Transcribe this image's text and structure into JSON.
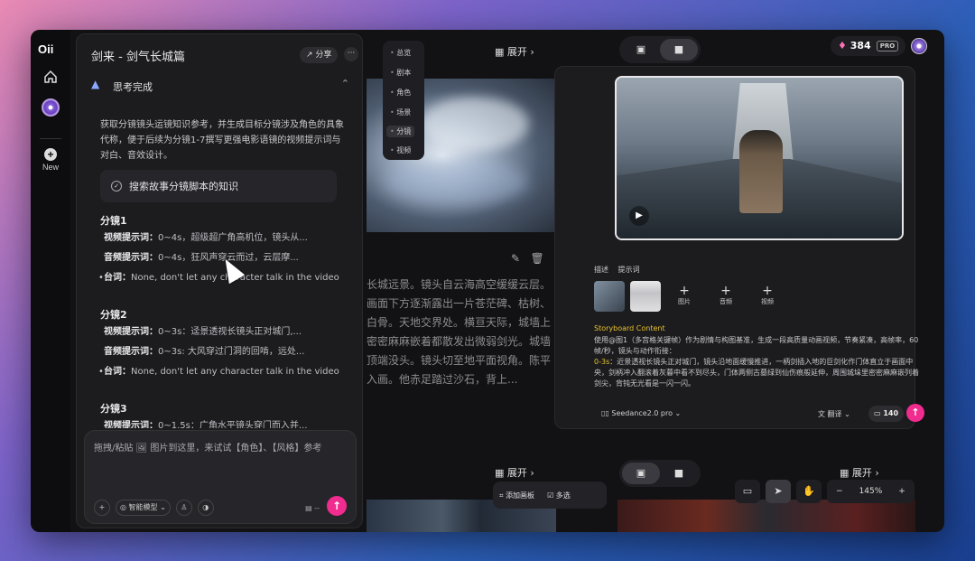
{
  "app": {
    "logo": "Oii",
    "new_label": "New"
  },
  "chat": {
    "title": "剑来 - 剑气长城篇",
    "share_label": "分享",
    "more_label": "···",
    "thinking_label": "思考完成",
    "intro": "获取分镜镜头运镜知识参考，并生成目标分镜涉及角色的具象代称，便于后续为分镜1-7撰写更强电影语镜的视频提示词与对白、音效设计。",
    "search_task": "搜索故事分镜脚本的知识",
    "shots": [
      {
        "heading": "分镜1",
        "video_label": "视频提示词：",
        "video_text": "0~4s，超级超广角高机位，镜头从...",
        "audio_label": "音频提示词：",
        "audio_text": "0~4s，狂风声穿云而过，云层摩...",
        "line_label": "台词：",
        "line_text": "None, don't let any character talk in the video"
      },
      {
        "heading": "分镜2",
        "video_label": "视频提示词：",
        "video_text": "0~3s：迳景透视长镜头正对城门,...",
        "audio_label": "音频提示词：",
        "audio_text": "0~3s: 大风穿过门洞的回啃，远处...",
        "line_label": "台词：",
        "line_text": "None, don't let any character talk in the video"
      },
      {
        "heading": "分镜3",
        "video_label": "视频提示词：",
        "video_text": "0~1.5s：广角水平镜头穿门而入并..."
      }
    ],
    "input_placeholder": "拖拽/粘贴 🖼 图片到这里，来试试【角色】、【风格】参考",
    "model_label": "智能模型",
    "input_count": "--"
  },
  "canvas": {
    "nav_items": [
      "总览",
      "剧本",
      "角色",
      "场景",
      "分镜",
      "视频"
    ],
    "nav_active": "分镜",
    "expand_label": "展开",
    "scene_text": "长城远景。镜头自云海高空缓缓云层。画面下方逐渐露出一片苍茫碑、枯树、白骨。天地交界处。横亘天际，城墙上密密麻麻嵌着都散发出微弱剑光。城墙顶端没头。镜头切至地平面视角。陈平入画。他赤足踏过沙石，背上...",
    "add_board_label": "添加画板",
    "multi_select_label": "多选"
  },
  "right": {
    "credits": "384",
    "pro_label": "PRO",
    "tabs": [
      "描述",
      "提示词"
    ],
    "add_items": [
      "图片",
      "音频",
      "视频"
    ],
    "sb_title": "Storyboard Content",
    "sb_body": "使用@图1（多宫格关键帧）作为剧情与构图基准，生成一段高质量动画视频，节奏紧凑，高帧率，60帧/秒，镜头与动作衔接：",
    "sb_ts": "0-3s",
    "sb_body2": "：近景透视长镜头正对城门，镜头沿地面缓慢推进，一柄剑插入地的巨剑化作门体直立于画面中央，剑柄冲入翻滚着灰暮中看不到尽头，门体两侧古墓绿到仙伤痕般延伸，周围城垛里密密麻麻嵌列着剑尖，背钝无光看是一闪一闪。",
    "model": "Seedance2.0 pro",
    "translate_label": "翻译",
    "cost": "140",
    "zoom_level": "145%"
  }
}
